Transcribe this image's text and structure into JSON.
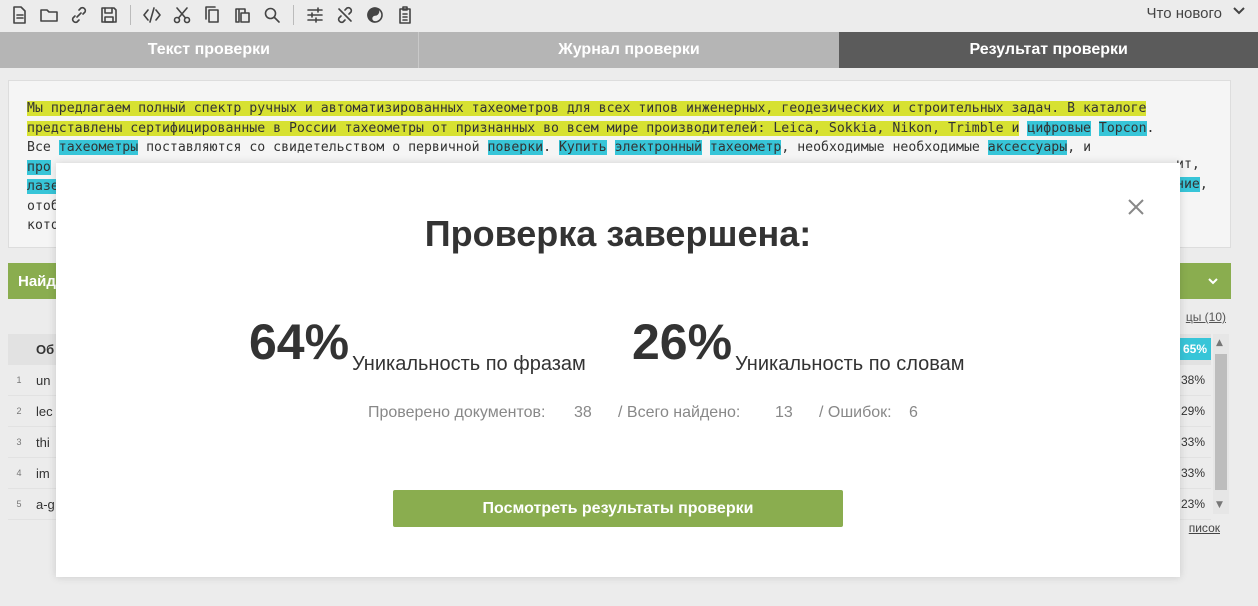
{
  "toolbar": {
    "icons": [
      "new-document-icon",
      "open-folder-icon",
      "link-icon",
      "save-icon",
      "code-icon",
      "cut-icon",
      "copy-icon",
      "paste-icon",
      "search-icon",
      "settings-list-icon",
      "unlink-icon",
      "yin-yang-icon",
      "clipboard-icon"
    ],
    "whats_new": "Что нового"
  },
  "tabs": {
    "check_text": "Текст проверки",
    "check_log": "Журнал проверки",
    "check_result": "Результат проверки"
  },
  "text_panel": {
    "segments": [
      {
        "t": "Мы предлагаем полный спектр ручных и автоматизированных тахеометров для всех типов инженерных, геодезических и строительных задач. В каталоге",
        "c": "y"
      },
      {
        "t": "\n",
        "c": ""
      },
      {
        "t": "представлены сертифицированные в России тахеометры от признанных во всем мире производителей: Leica, Sokkia, Nikon, Trimble и",
        "c": "y"
      },
      {
        "t": " ",
        "c": ""
      },
      {
        "t": "цифровые",
        "c": "b"
      },
      {
        "t": " ",
        "c": ""
      },
      {
        "t": "Topcon",
        "c": "b"
      },
      {
        "t": ".",
        "c": ""
      },
      {
        "t": "\nВсе ",
        "c": ""
      },
      {
        "t": "тахеометры",
        "c": "b"
      },
      {
        "t": " поставляются со свидетельством о первичной ",
        "c": ""
      },
      {
        "t": "поверки",
        "c": "b"
      },
      {
        "t": ". ",
        "c": ""
      },
      {
        "t": "Купить",
        "c": "b"
      },
      {
        "t": " ",
        "c": ""
      },
      {
        "t": "электронный",
        "c": "b"
      },
      {
        "t": " ",
        "c": ""
      },
      {
        "t": "тахеометр",
        "c": "b"
      },
      {
        "t": ", необходимые необходимые ",
        "c": ""
      },
      {
        "t": "аксессуары",
        "c": "b"
      },
      {
        "t": ", и",
        "c": ""
      },
      {
        "t": "\nпро",
        "c": "b"
      },
      {
        "t": "\nлазе",
        "c": "b"
      },
      {
        "t": "\nотоб",
        "c": ""
      },
      {
        "t": "\nкото",
        "c": ""
      }
    ],
    "right_fragments": [
      {
        "t": "ит,",
        "c": ""
      },
      {
        "t": "ние",
        "c": "b"
      },
      {
        "t": ",",
        "c": ""
      }
    ]
  },
  "found_bar": {
    "label": "Найд"
  },
  "sources_link": "цы (10)",
  "table": {
    "head": {
      "label": "Об",
      "pct": "65%"
    },
    "rows": [
      {
        "num": "1",
        "label": "un",
        "pct": "38%"
      },
      {
        "num": "2",
        "label": "lec",
        "pct": "29%"
      },
      {
        "num": "3",
        "label": "thi",
        "pct": "33%"
      },
      {
        "num": "4",
        "label": "im",
        "pct": "33%"
      },
      {
        "num": "5",
        "label": "a-g",
        "pct": "23%"
      }
    ]
  },
  "list_link": "писок",
  "modal": {
    "title": "Проверка завершена:",
    "phrase_uniqueness_value": "64%",
    "phrase_uniqueness_label": "Уникальность по фразам",
    "word_uniqueness_value": "26%",
    "word_uniqueness_label": "Уникальность по словам",
    "docs_checked_label": "Проверено документов:",
    "docs_checked_value": "38",
    "total_found_label": "/ Всего найдено:",
    "total_found_value": "13",
    "errors_label": "/ Ошибок:",
    "errors_value": "6",
    "button_label": "Посмотреть результаты проверки"
  },
  "colors": {
    "accent_green": "#8aad4f",
    "highlight_yellow": "#d7e132",
    "highlight_blue": "#37c5d8",
    "active_tab": "#5b5b5b"
  }
}
